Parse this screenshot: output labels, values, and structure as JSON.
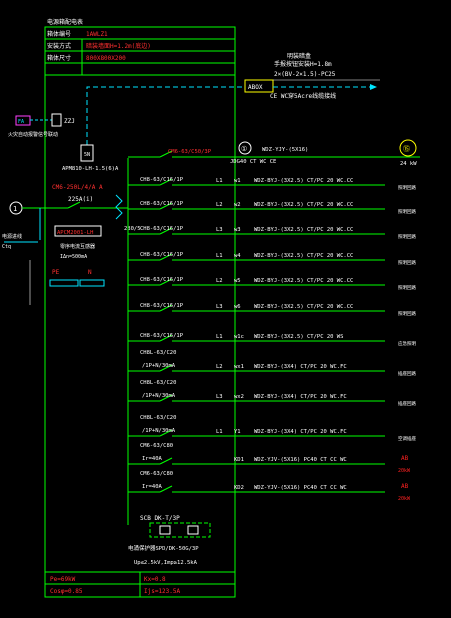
{
  "colors": {
    "background": "#000000",
    "frame": "#00ff00",
    "wire": "#00ff00",
    "label_white": "#ffffff",
    "breaker_red": "#ff3030",
    "aux_cyan": "#00e5ff",
    "power_red": "#ff2020",
    "load_yellow": "#ffff00",
    "equip_magenta": "#ff40ff"
  },
  "header": {
    "title": "电源箱配电表",
    "rows": [
      {
        "label": "箱体编号",
        "value": "1AWLZ1"
      },
      {
        "label": "安装方式",
        "value": "暗装墙面H=1.2m(底边)"
      },
      {
        "label": "箱体尺寸",
        "value": "800X800X200"
      }
    ]
  },
  "abox": {
    "label": "ABOX",
    "note_line1": "明装暗盒",
    "note_line2": "手报按钮安装H=1.8m",
    "cable_line1": "2×(BV-2×1.5)-PC25",
    "cable_line2": "CE WC穿5Acre线缆接线"
  },
  "fire": {
    "box_label": "FA",
    "relay_label": "ZZJ",
    "side_text": "火灾自动报警信号联动",
    "module_label": "APM810-LH-1.5(6)A",
    "module_sub": "5N"
  },
  "main_breaker": {
    "label": "CM6-250L/4/A A",
    "rating": "225A(i)",
    "spd_label": "APCM2001-LH",
    "leakage": "零序电流互感器",
    "trip": "IΔn=500mA",
    "isolator": "280/5",
    "incoming_text": "电源进线",
    "incoming_sub": "Ctq"
  },
  "busbars": {
    "pe": "PE",
    "n": "N"
  },
  "feeders": [
    {
      "breaker": "CM6-63/C50/3P",
      "phase": "",
      "circuit": "①",
      "cable": "WDZ-YJY-(5X16)",
      "cable2": "JDG40 CT WC CE",
      "load": "24 kW",
      "color": "red",
      "badge": "⑮"
    },
    {
      "breaker": "CH8-63/C16/1P",
      "phase": "L1",
      "circuit": "w1",
      "cable": "WDZ-BYJ-(3X2.5) CT/PC 20 WC.CC",
      "load": "照明回路"
    },
    {
      "breaker": "CH8-63/C16/1P",
      "phase": "L2",
      "circuit": "w2",
      "cable": "WDZ-BYJ-(3X2.5) CT/PC 20 WC.CC",
      "load": "照明回路"
    },
    {
      "breaker": "CH8-63/C16/1P",
      "phase": "L3",
      "circuit": "w3",
      "cable": "WDZ-BYJ-(3X2.5) CT/PC 20 WC.CC",
      "load": "照明回路"
    },
    {
      "breaker": "CH8-63/C16/1P",
      "phase": "L1",
      "circuit": "w4",
      "cable": "WDZ-BYJ-(3X2.5) CT/PC 20 WC.CC",
      "load": "照明回路"
    },
    {
      "breaker": "CH8-63/C16/1P",
      "phase": "L2",
      "circuit": "w5",
      "cable": "WDZ-BYJ-(3X2.5) CT/PC 20 WC.CC",
      "load": "照明回路"
    },
    {
      "breaker": "CH8-63/C16/1P",
      "phase": "L3",
      "circuit": "w6",
      "cable": "WDZ-BYJ-(3X2.5) CT/PC 20 WC.CC",
      "load": "照明回路"
    },
    {
      "breaker": "CH8-63/C16/1P",
      "phase": "L1",
      "circuit": "w1c",
      "cable": "WDZ-BYJ-(3X2.5) CT/PC 20 WS",
      "load": "应急照明"
    },
    {
      "breaker": "CH8L-63/C20",
      "breaker2": "/1P+N/30mA",
      "phase": "L2",
      "circuit": "wx1",
      "cable": "WDZ-BYJ-(3X4) CT/PC 20 WC.FC",
      "load": "插座回路"
    },
    {
      "breaker": "CH8L-63/C20",
      "breaker2": "/1P+N/30mA",
      "phase": "L3",
      "circuit": "wx2",
      "cable": "WDZ-BYJ-(3X4) CT/PC 20 WC.FC",
      "load": "插座回路"
    },
    {
      "breaker": "CH8L-63/C20",
      "breaker2": "/1P+N/30mA",
      "phase": "L1",
      "circuit": "Y1",
      "cable": "WDZ-BYJ-(3X4) CT/PC 20 WC.FC",
      "load": "空调插座"
    },
    {
      "breaker": "CM6-63/C80",
      "breaker2": "Ir=40A",
      "phase": "",
      "circuit": "KD1",
      "cable": "WDZ-YJV-(5X16) PC40 CT CC WC",
      "load": "AB",
      "load2": "20kW"
    },
    {
      "breaker": "CM6-63/C80",
      "breaker2": "Ir=40A",
      "phase": "",
      "circuit": "KD2",
      "cable": "WDZ-YJV-(5X16) PC40 CT CC WC",
      "load": "AB",
      "load2": "20kW"
    }
  ],
  "surge": {
    "label": "SCB DK-T/3P",
    "device": "电涌保护器SPD/DK-50G/3P",
    "spec": "Up≤2.5kV,Imp≥12.5kA"
  },
  "footer": {
    "pe": "Pe=69kW",
    "kx": "Kx=0.8",
    "cos": "Cosφ=0.85",
    "ijs": "Ijs=123.5A"
  }
}
